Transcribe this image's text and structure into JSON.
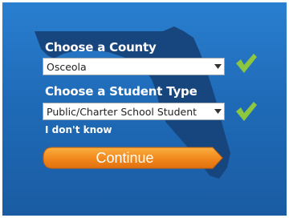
{
  "county": {
    "heading": "Choose a County",
    "selected": "Osceola"
  },
  "student_type": {
    "heading": "Choose a Student Type",
    "selected": "Public/Charter School Student"
  },
  "help_link": "I don't know",
  "continue_label": "Continue",
  "colors": {
    "background_top": "#2a7fd0",
    "background_bottom": "#1a5ca3",
    "map": "#17457d",
    "check": "#8dc63f",
    "button": "#f28a1e"
  },
  "icons": {
    "county_status": "check-icon",
    "student_status": "check-icon",
    "dropdown": "chevron-down-icon"
  }
}
